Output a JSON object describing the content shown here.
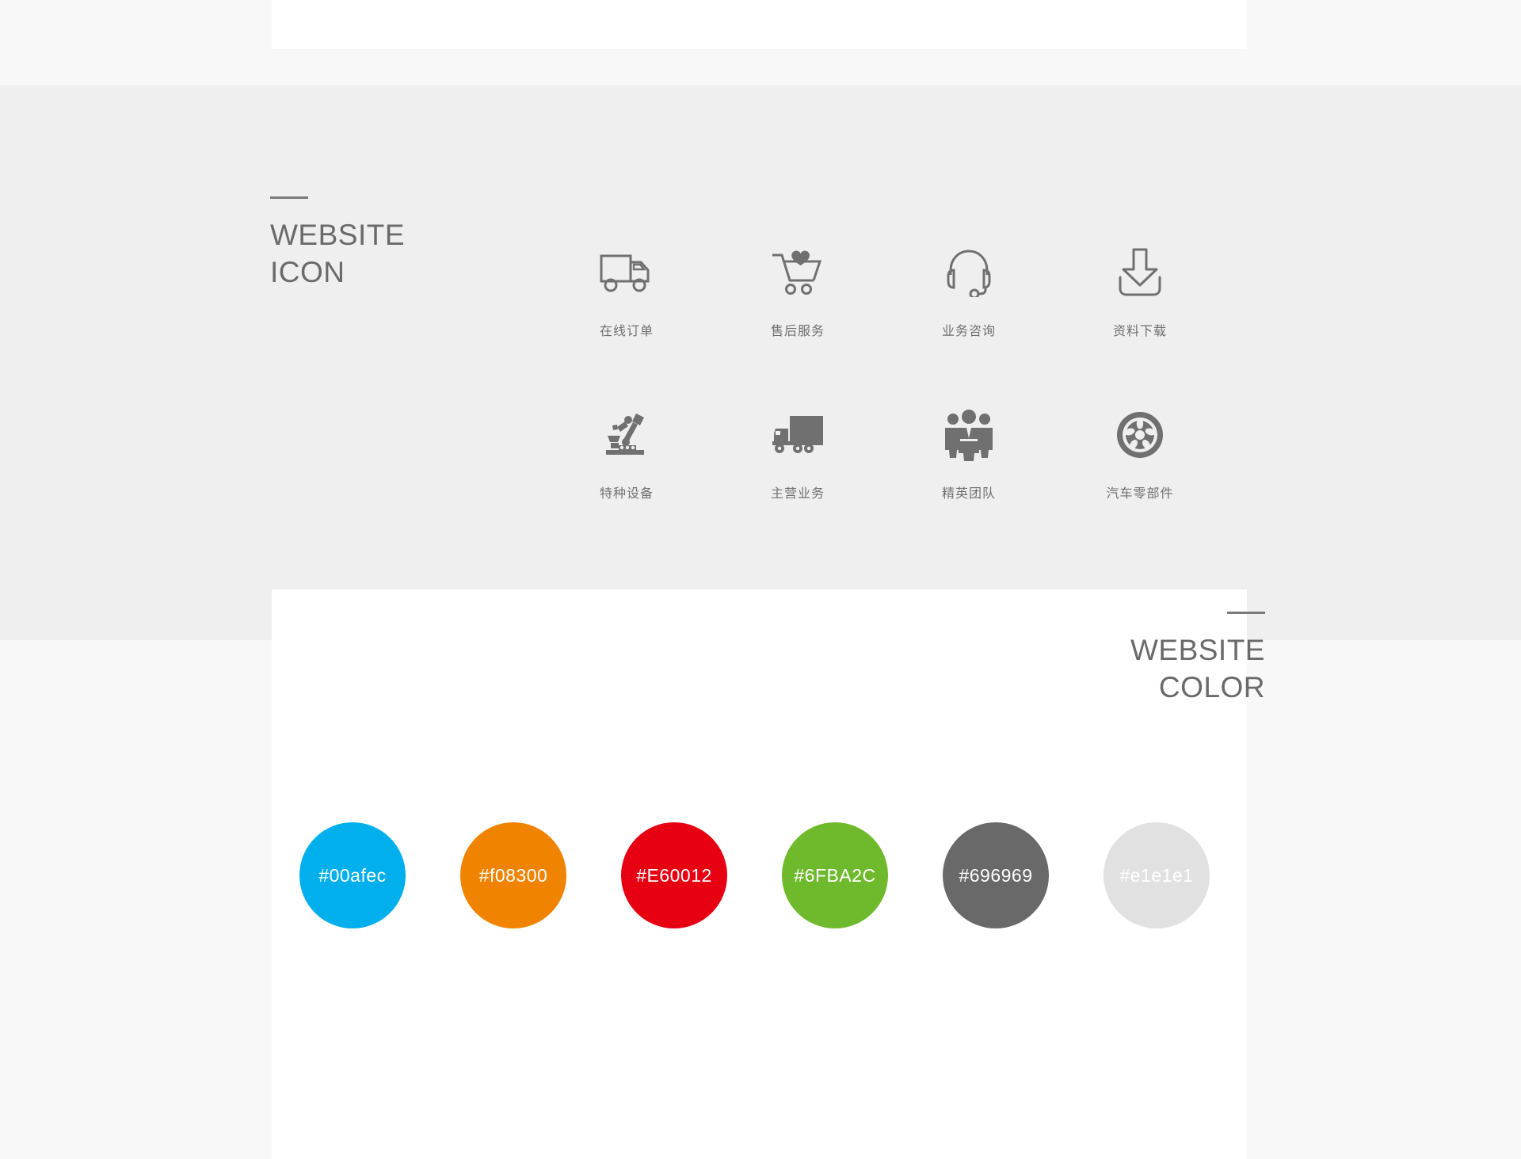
{
  "sections": {
    "icon": {
      "title_line1": "WEBSITE",
      "title_line2": "ICON"
    },
    "color": {
      "title_line1": "WEBSITE",
      "title_line2": "COLOR"
    }
  },
  "icons": [
    {
      "name": "delivery-truck-icon",
      "label": "在线订单"
    },
    {
      "name": "shopping-cart-heart-icon",
      "label": "售后服务"
    },
    {
      "name": "headset-icon",
      "label": "业务咨询"
    },
    {
      "name": "download-icon",
      "label": "资料下载"
    },
    {
      "name": "robotic-arm-icon",
      "label": "特种设备"
    },
    {
      "name": "semi-truck-icon",
      "label": "主营业务"
    },
    {
      "name": "team-people-icon",
      "label": "精英团队"
    },
    {
      "name": "car-wheel-icon",
      "label": "汽车零部件"
    }
  ],
  "palette": [
    {
      "hex": "#00afec",
      "label": "#00afec"
    },
    {
      "hex": "#f08300",
      "label": "#f08300"
    },
    {
      "hex": "#E60012",
      "label": "#E60012"
    },
    {
      "hex": "#6FBA2C",
      "label": "#6FBA2C"
    },
    {
      "hex": "#696969",
      "label": "#696969"
    },
    {
      "hex": "#e1e1e1",
      "label": "#e1e1e1"
    }
  ],
  "theme": {
    "page_background": "#f8f8f8",
    "gray_band": "#efefef",
    "panel_white": "#ffffff",
    "heading_color": "#6a6a6a",
    "icon_color": "#707070"
  }
}
